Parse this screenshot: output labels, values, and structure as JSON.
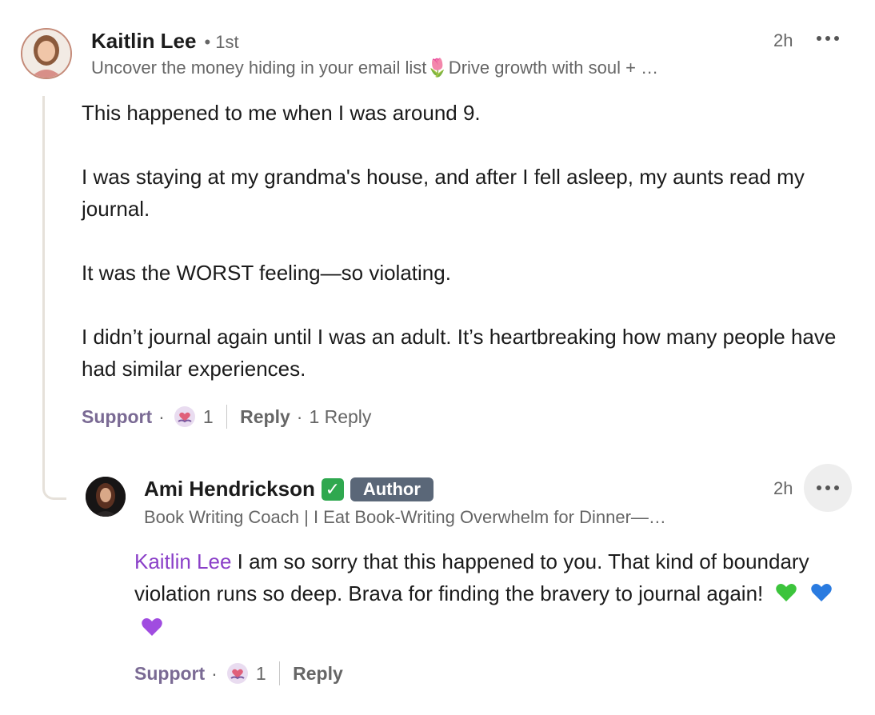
{
  "comment": {
    "author": "Kaitlin Lee",
    "degree": "• 1st",
    "headline": "Uncover the money hiding in your email list🌷Drive growth with soul + …",
    "time": "2h",
    "paragraphs": [
      "This happened to me when I was around 9.",
      "I was staying at my grandma's house, and after I fell asleep, my aunts read my journal.",
      "It was the WORST feeling—so violating.",
      "I didn’t journal again until I was an adult. It’s heartbreaking how many people have had similar experiences."
    ],
    "support_label": "Support",
    "reaction_count": "1",
    "reply_label": "Reply",
    "reply_count": "1 Reply",
    "dot": "·"
  },
  "reply": {
    "author": "Ami Hendrickson",
    "verified_mark": "✓",
    "badge": "Author",
    "headline": "Book Writing Coach | I Eat Book-Writing Overwhelm for Dinner—…",
    "time": "2h",
    "mention": "Kaitlin Lee",
    "text": " I am so sorry that this happened to you. That kind of boundary violation runs so deep. Brava for finding the bravery to journal again!",
    "support_label": "Support",
    "reaction_count": "1",
    "reply_label": "Reply",
    "dot": "·"
  },
  "colors": {
    "heart_green": "#3cc43c",
    "heart_blue": "#2a7be0",
    "heart_purple": "#a04ce0"
  }
}
